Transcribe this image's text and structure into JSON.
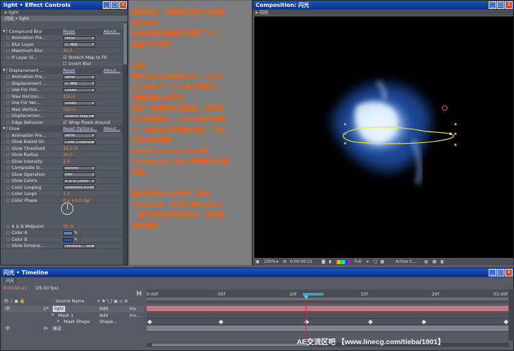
{
  "effect_controls": {
    "title": "light • Effect Controls",
    "tab": "light",
    "path": "闪光 • light",
    "rows": [
      {
        "kind": "head",
        "name": "Compound Blur",
        "link": "Reset",
        "about": "About..."
      },
      {
        "kind": "sel",
        "name": "Animation Pre...",
        "value": "None"
      },
      {
        "kind": "sel",
        "name": "Blur Layer",
        "value": "2. 噪波"
      },
      {
        "kind": "num",
        "name": "Maximum Blur",
        "value": "30.0"
      },
      {
        "kind": "chk",
        "name": "If Layer Si...",
        "value": "Stretch Map to Fit"
      },
      {
        "kind": "chk",
        "name": "",
        "value": "Invert Blur",
        "off": true
      },
      {
        "kind": "head",
        "name": "Displacement ...",
        "link": "Reset",
        "about": "About..."
      },
      {
        "kind": "sel",
        "name": "Animation Pre...",
        "value": "None"
      },
      {
        "kind": "sel",
        "name": "Displacement ...",
        "value": "2. 噪波"
      },
      {
        "kind": "sel",
        "name": "Use For Hor...",
        "value": "Green"
      },
      {
        "kind": "num",
        "name": "Max Horizon...",
        "value": "150.0"
      },
      {
        "kind": "sel",
        "name": "Use For Ver...",
        "value": "Green"
      },
      {
        "kind": "num",
        "name": "Max Vertica...",
        "value": "150.0"
      },
      {
        "kind": "sel",
        "name": "Displacemen...",
        "value": "Stretch Map to Fit"
      },
      {
        "kind": "chk",
        "name": "Edge Behavior",
        "value": "Wrap Pixels Around"
      },
      {
        "kind": "head",
        "name": "Glow",
        "link": "Reset Options...",
        "about": "About..."
      },
      {
        "kind": "sel",
        "name": "Animation Pre...",
        "value": "None"
      },
      {
        "kind": "sel",
        "name": "Glow Based On",
        "value": "Color Channels"
      },
      {
        "kind": "num",
        "name": "Glow Threshold",
        "value": "15.0 %"
      },
      {
        "kind": "num",
        "name": "Glow Radius",
        "value": "30.0"
      },
      {
        "kind": "num",
        "name": "Glow Intensity",
        "value": "1.0"
      },
      {
        "kind": "sel",
        "name": "Composite O...",
        "value": "Behind"
      },
      {
        "kind": "sel",
        "name": "Glow Operation",
        "value": "Add"
      },
      {
        "kind": "sel",
        "name": "Glow Colors",
        "value": "A & B Colors"
      },
      {
        "kind": "sel",
        "name": "Color Looping",
        "value": "Sawtooth A>B"
      },
      {
        "kind": "num",
        "name": "Color Loops",
        "value": "1.0"
      },
      {
        "kind": "num",
        "name": "Color Phase",
        "value": "0 x +0.0 dgr"
      },
      {
        "kind": "blank",
        "name": "",
        "value": ""
      },
      {
        "kind": "blank",
        "name": "",
        "value": ""
      },
      {
        "kind": "blank",
        "name": "",
        "value": ""
      },
      {
        "kind": "num",
        "name": "A & B Midpoint",
        "value": "50 %"
      },
      {
        "kind": "color",
        "name": "Color A",
        "value": ""
      },
      {
        "kind": "color",
        "name": "Color B",
        "value": ""
      },
      {
        "kind": "sel",
        "name": "Glow Dimens...",
        "value": "Horizont... Vertical"
      }
    ],
    "color_a": "#5a80d8",
    "color_b": "#2a4fc8"
  },
  "instructions": {
    "lines": [
      "新建合成，用最熟悉的方法创建",
      "波动光效",
      "这种效果的教程已经满天飞了，",
      "这里不作赘述",
      "",
      "注意：",
      "调节Mask动画的运动，让它从",
      "左上到右下，从小到大再到小，",
      "尽量是扁长的形状",
      "噪波一定要用合成图层，且噪波",
      "对比度要调大，Scale值适当缩",
      "小，相应和位移要做动画，并且",
      "作适当的模糊",
      "Displacement Map和",
      "Compound Blur参数要对应着",
      "调整。",
      "",
      "最后添加Glow特效，降低",
      "Treshold，并且打高Radius",
      "，给它蓝色的色彩倾向，具体看",
      "效果调整"
    ]
  },
  "composition": {
    "title": "Composition: 闪光",
    "tab": "闪光",
    "zoom": "100%",
    "timecode": "0:00:00:11",
    "resolution": "Full",
    "camera": "Active C..."
  },
  "timeline": {
    "title": "闪光 • Timeline",
    "tab": "闪光",
    "timecode": "0:00:00:11",
    "fps": "(25.00 fps)",
    "col_source": "Source Name",
    "col_mode": "M",
    "layers": [
      {
        "num": "1",
        "name": "light",
        "mode": "Add",
        "trk": "Inv"
      },
      {
        "num": "",
        "name": "Mask 1",
        "mode": "Add",
        "trk": "Inv..."
      },
      {
        "num": "",
        "name": "Mask Shape",
        "mode": "Shape...",
        "trk": ""
      },
      {
        "num": "2",
        "name": "噪波",
        "mode": "",
        "trk": ""
      }
    ],
    "ruler": [
      "0:00f",
      "05f",
      "10f",
      "15f",
      "20f",
      "01:00f"
    ],
    "current_fraction": 0.44
  },
  "watermark": "AE交流区吧  【www.linecg.com/tieba/1801】"
}
